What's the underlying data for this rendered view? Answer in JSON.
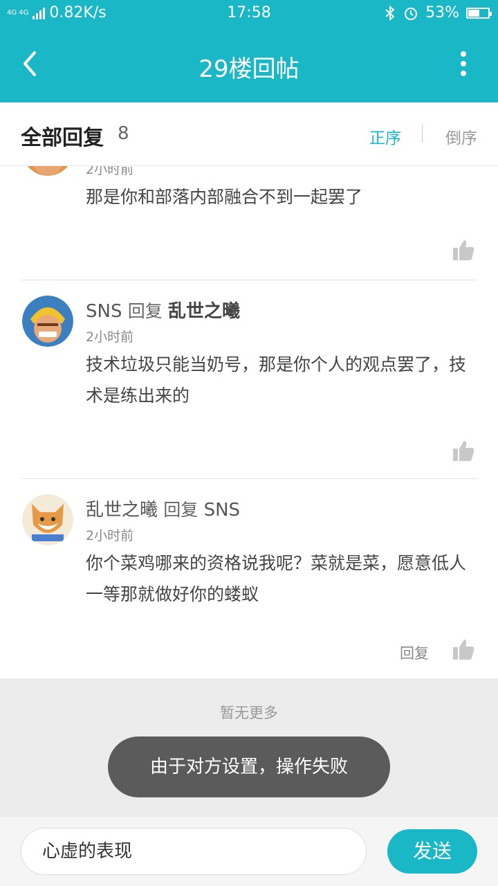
{
  "status_bar": {
    "network_label": "4G 4G",
    "speed": "0.82K/s",
    "time": "17:58",
    "battery_percent_text": "53%",
    "battery_level": 0.53
  },
  "nav": {
    "back_icon": "chevron-left-icon",
    "title": "29楼回帖",
    "more_icon": "more-vertical-icon"
  },
  "replies_header": {
    "title": "全部回复",
    "count": "8",
    "sort_asc_label": "正序",
    "sort_desc_label": "倒序",
    "active_sort": "asc"
  },
  "replies": [
    {
      "time": "2小时前",
      "text": "那是你和部落内部融合不到一起罢了"
    },
    {
      "author": "SNS",
      "verb": "回复",
      "target": "乱世之曦",
      "time": "2小时前",
      "text": "技术垃圾只能当奶号，那是你个人的观点罢了，技术是练出来的"
    },
    {
      "author": "乱世之曦",
      "verb": "回复",
      "target": "SNS",
      "time": "2小时前",
      "text": "你个菜鸡哪来的资格说我呢？菜就是菜，愿意低人一等那就做好你的蝼蚁",
      "reply_label": "回复"
    }
  ],
  "footer": {
    "no_more": "暂无更多",
    "toast": "由于对方设置，操作失败"
  },
  "input_bar": {
    "input_value": "心虚的表现",
    "send_label": "发送"
  },
  "colors": {
    "accent": "#1ab8c6",
    "toast_bg": "#5b5b5b",
    "footer_bg": "#ececec"
  }
}
